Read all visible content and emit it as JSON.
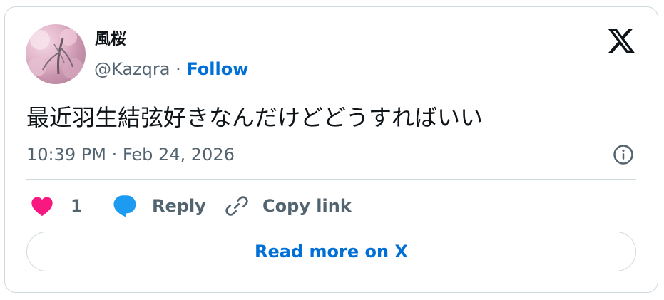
{
  "author": {
    "display_name": "風桜",
    "handle": "@Kazqra",
    "separator": "·",
    "follow_label": "Follow"
  },
  "tweet": {
    "text": "最近羽生結弦好きなんだけどどうすればいい",
    "timestamp": "10:39 PM · Feb 24, 2026"
  },
  "actions": {
    "like_count": "1",
    "reply_label": "Reply",
    "copy_label": "Copy link"
  },
  "read_more_label": "Read more on X",
  "icons": {
    "brand": "x-logo-icon",
    "info": "info-icon",
    "like": "heart-icon",
    "reply": "speech-bubble-icon",
    "copy": "link-icon"
  },
  "colors": {
    "link_blue": "#006fd6",
    "heart_pink": "#f91880",
    "reply_blue": "#1d9bf0",
    "secondary_text": "#536471",
    "primary_text": "#0f1419",
    "border": "#cfd9de"
  }
}
